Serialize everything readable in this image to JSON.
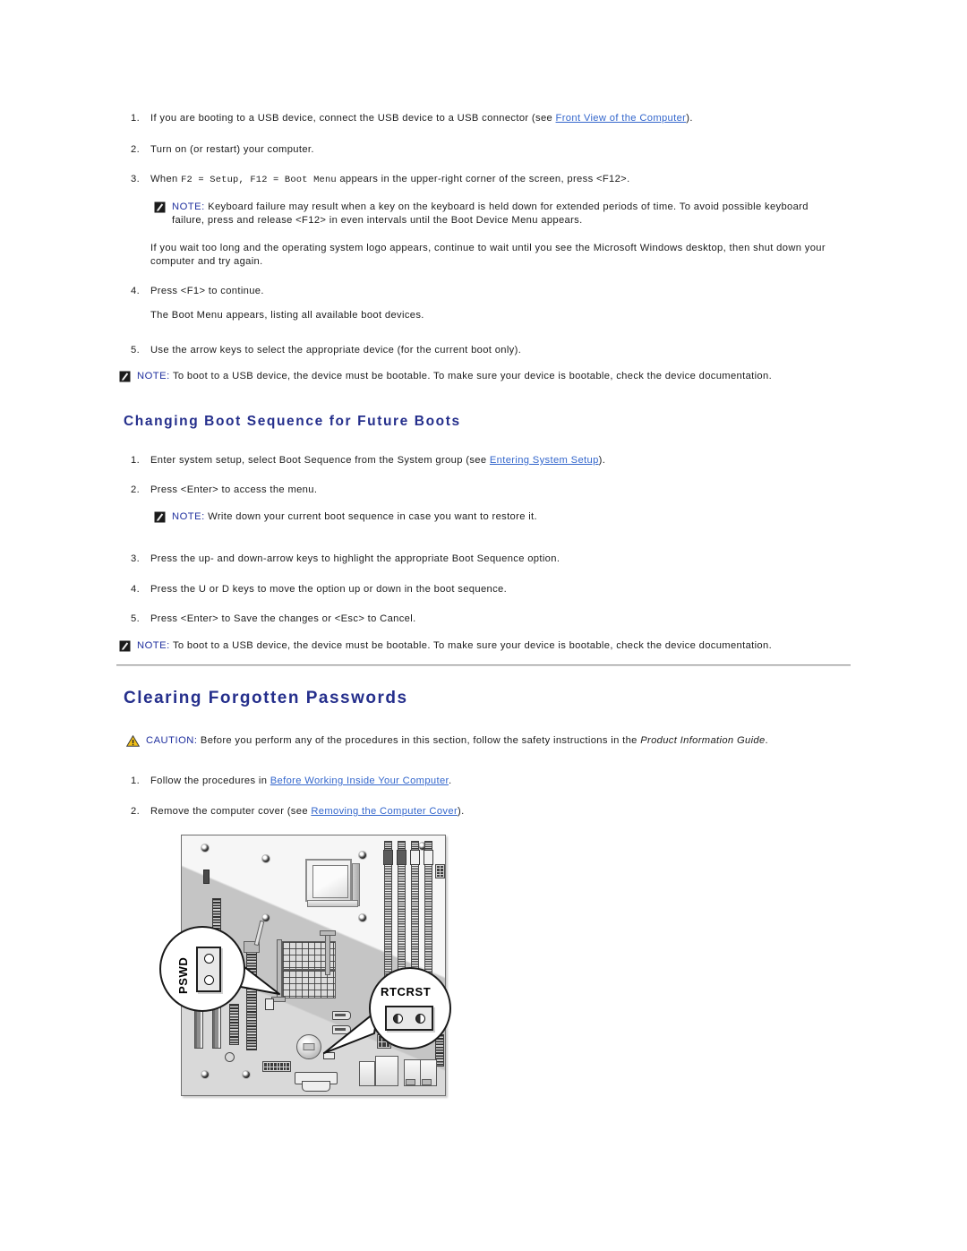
{
  "document": {
    "title": "Clearing Forgotten Passwords"
  },
  "boot_now": {
    "items": [
      {
        "num": "1.",
        "text_before": "If you are booting to a USB device, connect the USB device to a USB connector (see ",
        "link": "Front View of the Computer",
        "text_after": ")."
      },
      {
        "num": "2.",
        "text_before": "Turn on (or restart) your computer.",
        "link": "",
        "text_after": ""
      },
      {
        "num": "3.",
        "text_before": "When ",
        "mono": "F2 = Setup, F12 = Boot Menu",
        "text_after": " appears in the upper-right corner of the screen, press <F12>."
      },
      {
        "num": "4.",
        "text_before": "Press <F1> to continue.",
        "link": "",
        "text_after": ""
      },
      {
        "num": "5.",
        "text_before": "Use the arrow keys to select the appropriate device (for the current boot only).",
        "link": "",
        "text_after": ""
      }
    ],
    "note_keyboard": {
      "keyword": "NOTE:",
      "text": " Keyboard failure may result when a key on the keyboard is held down for extended periods of time. To avoid possible keyboard failure, press and release <F12> in even intervals until the Boot Device Menu appears."
    },
    "para_wait": "If you wait too long and the operating system logo appears, continue to wait until you see the Microsoft Windows desktop, then shut down your computer and try again.",
    "para_bootmenu": "The Boot Menu appears, listing all available boot devices.",
    "note_usb": {
      "keyword": "NOTE:",
      "text": " To boot to a USB device, the device must be bootable. To make sure your device is bootable, check the device documentation."
    }
  },
  "future_boots": {
    "heading": "Changing Boot Sequence for Future Boots",
    "items": [
      {
        "num": "1.",
        "text_before": "Enter system setup, select Boot Sequence from the System group (see ",
        "link": "Entering System Setup",
        "text_after": ")."
      },
      {
        "num": "2.",
        "text_before": "Press <Enter> to access the menu.",
        "link": "",
        "text_after": ""
      },
      {
        "num": "3.",
        "text_before": "Press the up- and down-arrow keys to highlight the appropriate Boot Sequence option.",
        "link": "",
        "text_after": ""
      },
      {
        "num": "4.",
        "text_before": "Press the U or D keys to move the option up or down in the boot sequence.",
        "link": "",
        "text_after": ""
      },
      {
        "num": "5.",
        "text_before": "Press <Enter> to Save the changes or <Esc> to Cancel.",
        "link": "",
        "text_after": ""
      }
    ],
    "note_writedown": {
      "keyword": "NOTE:",
      "text": " Write down your current boot sequence in case you want to restore it."
    },
    "note_usb": {
      "keyword": "NOTE:",
      "text": " To boot to a USB device, the device must be bootable. To make sure your device is bootable, check the device documentation."
    }
  },
  "clearing_passwords": {
    "heading": "Clearing Forgotten Passwords",
    "caution": {
      "keyword": "CAUTION:",
      "text_before": " Before you perform any of the procedures in this section, follow the safety instructions in the ",
      "italic": "Product Information Guide",
      "text_after": "."
    },
    "items": [
      {
        "num": "1.",
        "text_before": "Follow the procedures in ",
        "link": "Before Working Inside Your Computer",
        "text_after": "."
      },
      {
        "num": "2.",
        "text_before": "Remove the computer cover (see ",
        "link": "Removing the Computer Cover",
        "text_after": ")."
      }
    ]
  },
  "diagram": {
    "name": "system-board-jumpers",
    "callouts": [
      {
        "label": "PSWD",
        "orientation": "vertical",
        "pins": 2
      },
      {
        "label": "RTCRST",
        "orientation": "horizontal",
        "pins": 2
      }
    ]
  },
  "colors": {
    "heading": "#252f8c",
    "link": "#3366cc",
    "note_keyword": "#1f2f9e",
    "caution_icon": "#f2c017",
    "board": "#d9d9d9",
    "text": "#1c1c1c"
  }
}
